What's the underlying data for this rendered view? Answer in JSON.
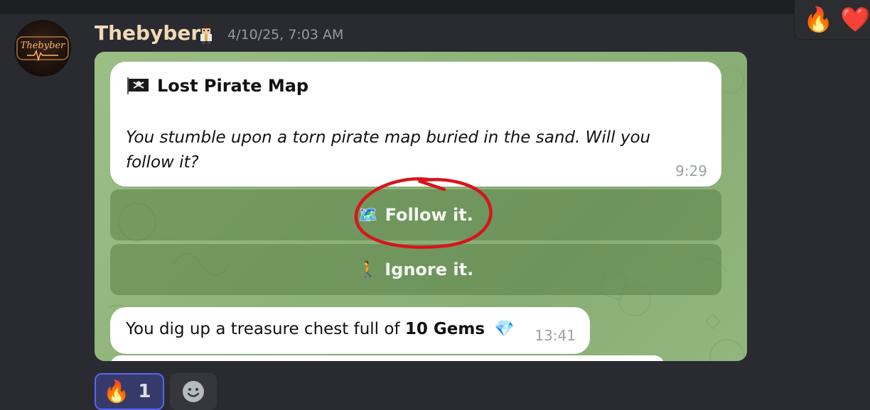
{
  "message": {
    "username": "Thebyber",
    "timestamp": "4/10/25, 7:03 AM",
    "avatar_text": "Thebyber"
  },
  "hover_toolbar": {
    "reactions": [
      "🔥",
      "❤️"
    ]
  },
  "attachment": {
    "event_title": "Lost Pirate Map",
    "event_body": "You stumble upon a torn pirate map buried in the sand. Will you follow it?",
    "event_time": "9:29",
    "buttons": [
      {
        "emoji": "🗺️",
        "label": "Follow it."
      },
      {
        "emoji": "🚶",
        "label": "Ignore it."
      }
    ],
    "result_text_prefix": "You dig up a treasure chest full of ",
    "result_text_bold": "10 Gems",
    "result_emoji": "💎",
    "result_time": "13:41",
    "annotation_color": "#d8141c"
  },
  "reactions": [
    {
      "emoji": "🔥",
      "count": "1"
    }
  ],
  "colors": {
    "username": "#f0d9b5",
    "reaction_border": "#5865f2"
  }
}
